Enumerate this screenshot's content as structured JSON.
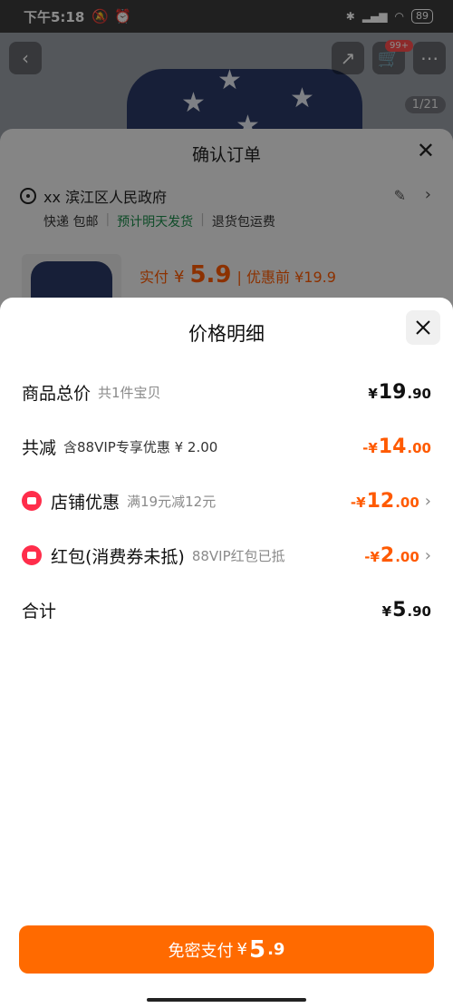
{
  "status_bar": {
    "time": "下午5:18",
    "battery": "89"
  },
  "background": {
    "page_counter": "1/21",
    "cart_badge": "99+",
    "confirm_order": {
      "title": "确认订单",
      "address": "xx 滨江区人民政府",
      "shipping": "快递 包邮",
      "dispatch": "预计明天发货",
      "return": "退货包运费",
      "pay_label": "实付",
      "pay_currency": "¥",
      "pay_amount": "5.9",
      "before_discount": "| 优惠前 ¥19.9"
    }
  },
  "price_detail": {
    "title": "价格明细",
    "rows": [
      {
        "label": "商品总价",
        "sub": "共1件宝贝",
        "currency": "¥",
        "int": "19",
        "dec": ".90",
        "tone": "black"
      },
      {
        "label": "共减",
        "sub": "含88VIP专享优惠 ¥ 2.00",
        "currency": "-¥",
        "int": "14",
        "dec": ".00",
        "tone": "orange"
      },
      {
        "label": "店铺优惠",
        "sub": "满19元减12元",
        "currency": "-¥",
        "int": "12",
        "dec": ".00",
        "tone": "orange",
        "icon": "coupon-icon"
      },
      {
        "label": "红包(消费券未抵)",
        "sub": "88VIP红包已抵",
        "currency": "-¥",
        "int": "2",
        "dec": ".00",
        "tone": "orange",
        "icon": "red-packet-icon"
      },
      {
        "label": "合计",
        "sub": "",
        "currency": "¥",
        "int": "5",
        "dec": ".90",
        "tone": "black"
      }
    ]
  },
  "pay_button": {
    "label": "免密支付",
    "currency": "¥",
    "int": "5",
    "dec": ".9"
  },
  "colors": {
    "accent": "#ff6a00",
    "discount": "#ff5a00",
    "coupon": "#ff2d4b"
  }
}
